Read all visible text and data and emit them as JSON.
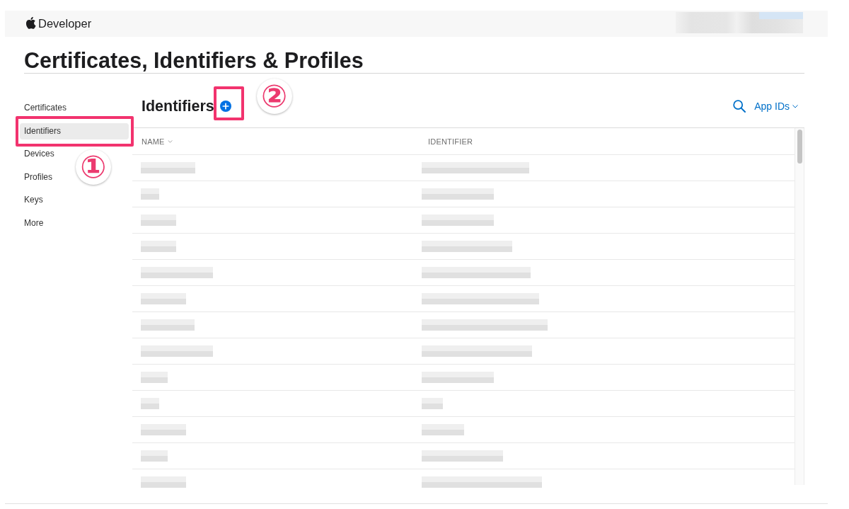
{
  "header": {
    "brand": "Developer",
    "account_redacted": true
  },
  "page_title": "Certificates, Identifiers & Profiles",
  "sidebar": {
    "items": [
      {
        "label": "Certificates",
        "selected": false
      },
      {
        "label": "Identifiers",
        "selected": true,
        "annotation": "①"
      },
      {
        "label": "Devices",
        "selected": false
      },
      {
        "label": "Profiles",
        "selected": false
      },
      {
        "label": "Keys",
        "selected": false
      },
      {
        "label": "More",
        "selected": false
      }
    ]
  },
  "section": {
    "title": "Identifiers",
    "add_annotation": "②",
    "filter": {
      "label": "App IDs"
    }
  },
  "table": {
    "columns": [
      {
        "label": "NAME",
        "sort_indicator": true
      },
      {
        "label": "IDENTIFIER",
        "sort_indicator": false
      }
    ],
    "rows": [
      {
        "kind": "redacted"
      },
      {
        "kind": "redacted"
      },
      {
        "kind": "redacted"
      },
      {
        "kind": "redacted"
      },
      {
        "kind": "redacted"
      },
      {
        "kind": "redacted"
      },
      {
        "kind": "redacted"
      },
      {
        "kind": "redacted"
      },
      {
        "kind": "redacted"
      },
      {
        "kind": "redacted"
      },
      {
        "kind": "redacted"
      },
      {
        "kind": "redacted"
      },
      {
        "kind": "redacted"
      }
    ]
  }
}
